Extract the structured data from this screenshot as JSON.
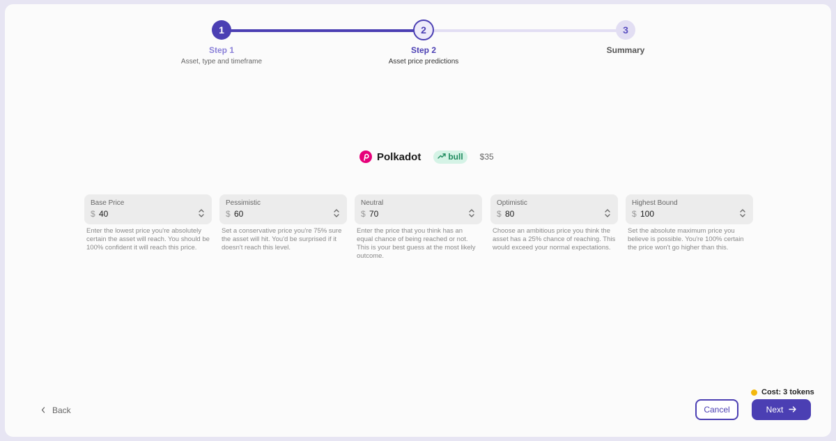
{
  "stepper": {
    "steps": [
      {
        "number": "1",
        "title": "Step 1",
        "description": "Asset, type and timeframe"
      },
      {
        "number": "2",
        "title": "Step 2",
        "description": "Asset price predictions"
      },
      {
        "number": "3",
        "title": "Summary",
        "description": ""
      }
    ],
    "current_step": 2
  },
  "asset": {
    "name": "Polkadot",
    "trend": "bull",
    "price": "$35",
    "icon": "polkadot-icon",
    "brand_color": "#e6007a"
  },
  "fields": [
    {
      "label": "Base Price",
      "currency": "$",
      "value": "40",
      "help": "Enter the lowest price you're absolutely certain the asset will reach. You should be 100% confident it will reach this price."
    },
    {
      "label": "Pessimistic",
      "currency": "$",
      "value": "60",
      "help": "Set a conservative price you're 75% sure the asset will hit. You'd be surprised if it doesn't reach this level."
    },
    {
      "label": "Neutral",
      "currency": "$",
      "value": "70",
      "help": "Enter the price that you think has an equal chance of being reached or not. This is your best guess at the most likely outcome."
    },
    {
      "label": "Optimistic",
      "currency": "$",
      "value": "80",
      "help": "Choose an ambitious price you think the asset has a 25% chance of reaching. This would exceed your normal expectations."
    },
    {
      "label": "Highest Bound",
      "currency": "$",
      "value": "100",
      "help": "Set the absolute maximum price you believe is possible. You're 100% certain the price won't go higher than this."
    }
  ],
  "footer": {
    "back_label": "Back",
    "cost_label": "Cost: 3 tokens",
    "cancel_label": "Cancel",
    "next_label": "Next"
  },
  "colors": {
    "accent": "#4b3fb3",
    "bull_badge_bg": "#d5f3e6",
    "bull_badge_text": "#1f8a5e",
    "cost_dot": "#f3b80f"
  }
}
